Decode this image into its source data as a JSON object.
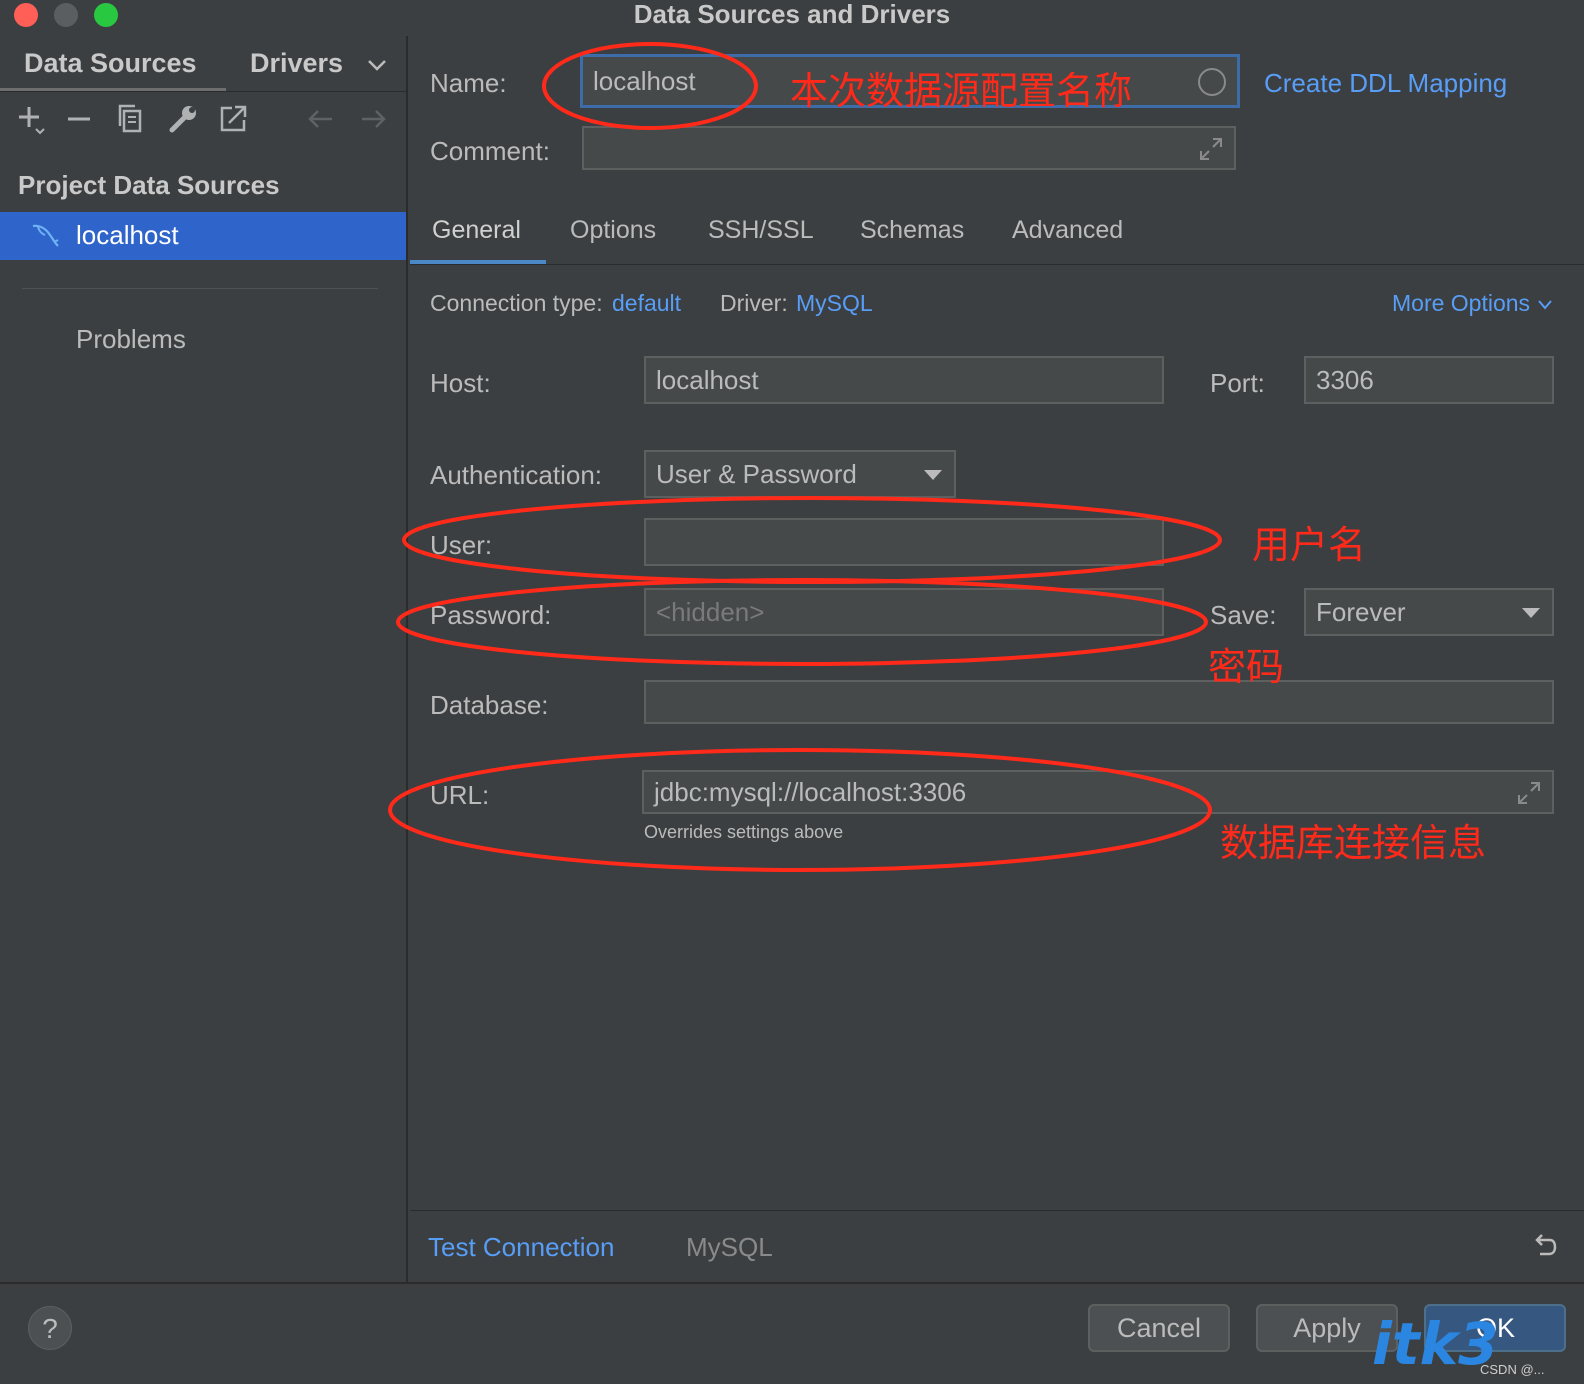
{
  "window": {
    "title": "Data Sources and Drivers"
  },
  "sidebar": {
    "tabs": {
      "data_sources": "Data Sources",
      "drivers": "Drivers"
    },
    "toolbar_icons": [
      "add-icon",
      "remove-icon",
      "copy-icon",
      "wrench-icon",
      "export-icon",
      "back-arrow-icon",
      "forward-arrow-icon"
    ],
    "heading": "Project Data Sources",
    "selected_item": "localhost",
    "problems": "Problems"
  },
  "form": {
    "name_label": "Name:",
    "name_value": "localhost",
    "create_ddl": "Create DDL Mapping",
    "comment_label": "Comment:",
    "tabs": [
      "General",
      "Options",
      "SSH/SSL",
      "Schemas",
      "Advanced"
    ],
    "connection_type_label": "Connection type:",
    "connection_type_value": "default",
    "driver_label": "Driver:",
    "driver_value": "MySQL",
    "more_options": "More Options",
    "host_label": "Host:",
    "host_value": "localhost",
    "port_label": "Port:",
    "port_value": "3306",
    "auth_label": "Authentication:",
    "auth_value": "User & Password",
    "user_label": "User:",
    "user_value": "",
    "password_label": "Password:",
    "password_placeholder": "<hidden>",
    "save_label": "Save:",
    "save_value": "Forever",
    "database_label": "Database:",
    "database_value": "",
    "url_label": "URL:",
    "url_value": "jdbc:mysql://localhost:3306",
    "url_hint": "Overrides settings above"
  },
  "footer": {
    "test_connection": "Test Connection",
    "driver_name": "MySQL"
  },
  "buttons": {
    "help": "?",
    "cancel": "Cancel",
    "apply": "Apply",
    "ok": "OK"
  },
  "annotations": {
    "name": "本次数据源配置名称",
    "user": "用户名",
    "password": "密码",
    "url": "数据库连接信息"
  },
  "watermark": {
    "main": "itk3",
    "small": "CSDN @..."
  },
  "colors": {
    "accent_link": "#589df6",
    "selection": "#2f65ca",
    "annotation": "#ff2a1a"
  }
}
